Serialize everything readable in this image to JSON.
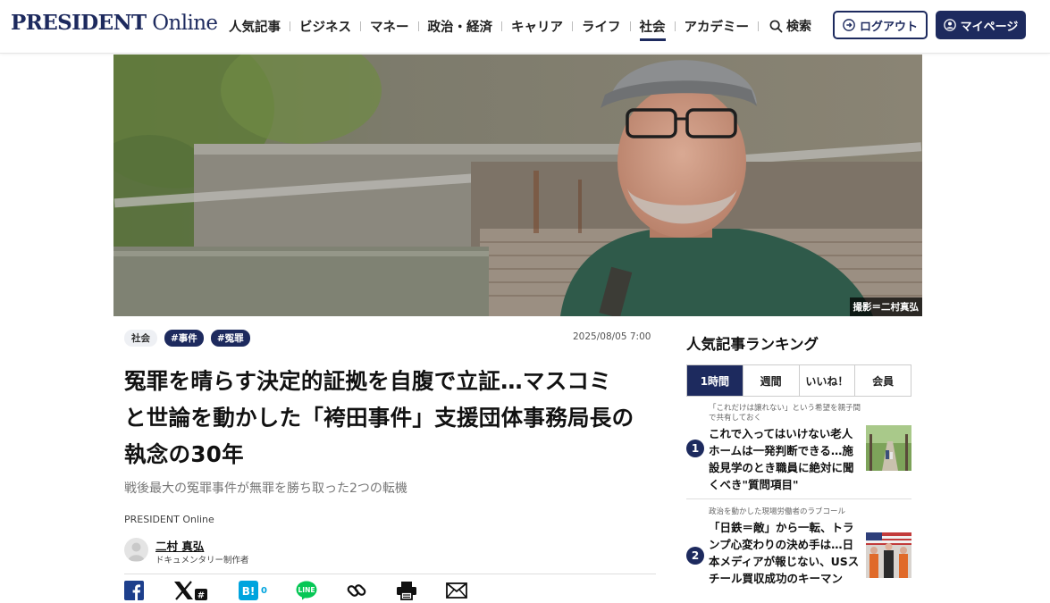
{
  "header": {
    "logo_bold": "PRESIDENT",
    "logo_light": " Online",
    "nav": [
      {
        "label": "人気記事",
        "active": false
      },
      {
        "label": "ビジネス",
        "active": false
      },
      {
        "label": "マネー",
        "active": false
      },
      {
        "label": "政治・経済",
        "active": false
      },
      {
        "label": "キャリア",
        "active": false
      },
      {
        "label": "ライフ",
        "active": false
      },
      {
        "label": "社会",
        "active": true
      },
      {
        "label": "アカデミー",
        "active": false
      }
    ],
    "search_label": "検索",
    "logout_label": "ログアウト",
    "mypage_label": "マイページ"
  },
  "hero": {
    "photo_credit": "撮影＝二村真弘"
  },
  "article": {
    "tags": [
      "社会",
      "#事件",
      "#冤罪"
    ],
    "date": "2025/08/05 7:00",
    "title_lines": [
      "冤罪を晴らす決定的証拠を自腹で立証…マスコミ",
      "と世論を動かした「袴田事件」支援団体事務局長の",
      "執念の30年"
    ],
    "subtitle": "戦後最大の冤罪事件が無罪を勝ち取った2つの転機",
    "source": "PRESIDENT Online",
    "author_name": "二村 真弘",
    "author_role": "ドキュメンタリー制作者",
    "share": {
      "hatena_count": "0",
      "icons": [
        "facebook-icon",
        "x-icon",
        "hatena-icon",
        "line-icon",
        "link-icon",
        "print-icon",
        "mail-icon"
      ]
    }
  },
  "ranking": {
    "title": "人気記事ランキング",
    "tabs": [
      {
        "label": "1時間",
        "active": true
      },
      {
        "label": "週間",
        "active": false
      },
      {
        "label": "いいね！",
        "active": false
      },
      {
        "label": "会員",
        "active": false
      }
    ],
    "items": [
      {
        "rank": "1",
        "kicker": "「これだけは譲れない」という希望を親子間で共有しておく",
        "headline": "これで入ってはいけない老人ホームは一発判断できる…施設見学のとき職員に絶対に聞くべき\"質問項目\""
      },
      {
        "rank": "2",
        "kicker": "政治を動かした現場労働者のラブコール",
        "headline": "「日鉄＝敵」から一転、トランプ心変わりの決め手は…日本メディアが報じない、USスチール買収成功のキーマン"
      }
    ]
  },
  "colors": {
    "brand_navy": "#1d2a5e",
    "line_green": "#06c755",
    "facebook_blue": "#1877f2",
    "hatena_blue": "#00a4de"
  }
}
